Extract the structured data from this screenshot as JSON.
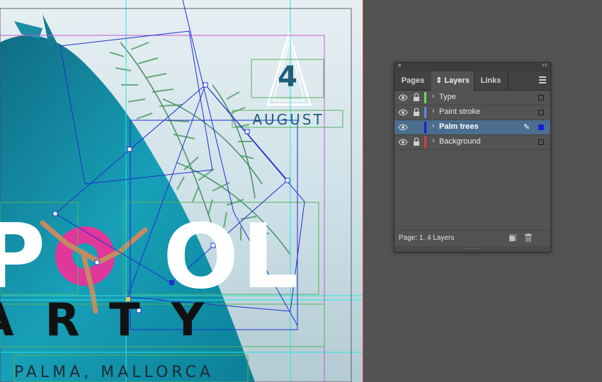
{
  "poster": {
    "day": "4",
    "month": "AUGUST",
    "headline_p": "P",
    "headline_ol": "OL",
    "subhead": "ARTY",
    "location": "PALMA, MALLORCA"
  },
  "panel": {
    "tabs": [
      {
        "label": "Pages"
      },
      {
        "label": "Layers",
        "prefix": "⇕"
      },
      {
        "label": "Links"
      }
    ],
    "active_tab": "Layers",
    "layers": [
      {
        "name": "Type",
        "color": "#6ddc56",
        "locked": true,
        "visible": true,
        "selected": false
      },
      {
        "name": "Paint stroke",
        "color": "#5a8de8",
        "locked": true,
        "visible": true,
        "selected": false
      },
      {
        "name": "Palm trees",
        "color": "#1c1cd6",
        "locked": false,
        "visible": true,
        "selected": true
      },
      {
        "name": "Background",
        "color": "#e23a3a",
        "locked": true,
        "visible": true,
        "selected": false
      }
    ],
    "footer": "Page: 1, 4 Layers"
  },
  "icons": {
    "close": "close-icon",
    "collapse": "collapse-icon",
    "menu": "panel-menu-icon",
    "visibility": "eye-icon",
    "lock": "lock-icon",
    "expand": "chevron-right-icon",
    "edit": "pencil-icon",
    "new_layer": "new-layer-icon",
    "delete": "trash-icon"
  }
}
